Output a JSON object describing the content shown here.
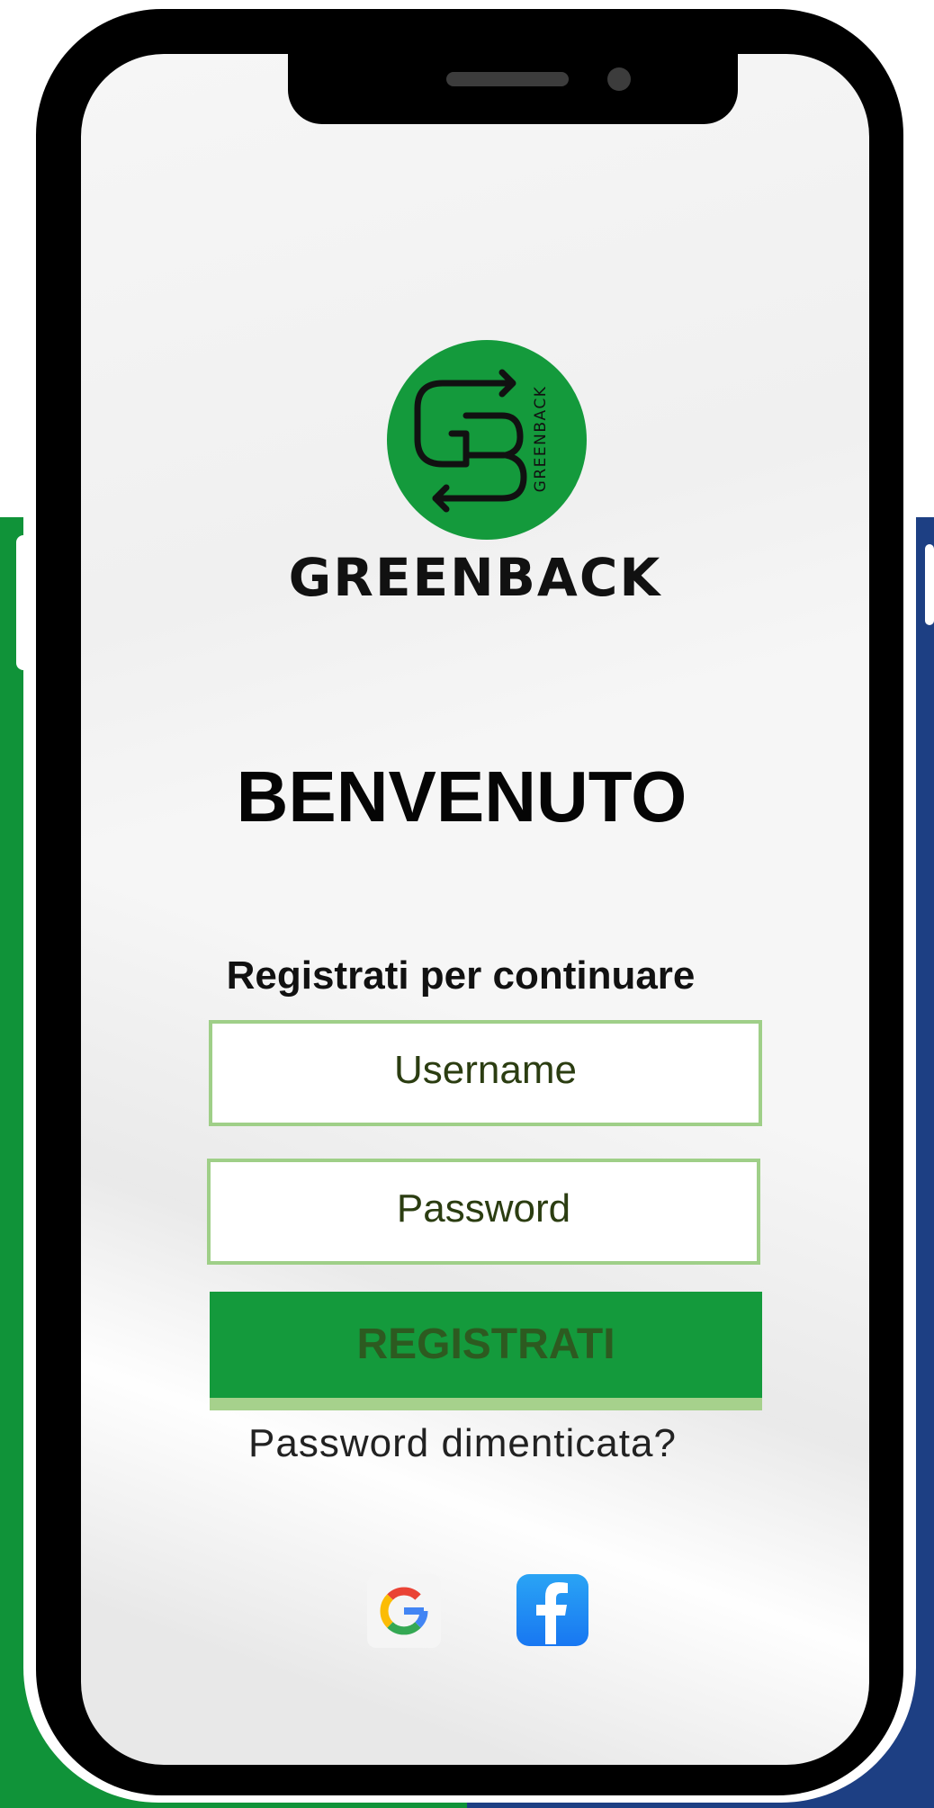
{
  "app": {
    "brand_name": "GREENBACK",
    "logo_monogram": "GB",
    "logo_ring_text": "GREENBACK"
  },
  "login": {
    "welcome_title": "BENVENUTO",
    "subtitle": "Registrati per continuare",
    "username_placeholder": "Username",
    "password_placeholder": "Password",
    "register_label": "REGISTRATI",
    "forgot_password_label": "Password dimenticata?"
  },
  "social": {
    "google_icon": "google-icon",
    "facebook_icon": "facebook-icon"
  },
  "colors": {
    "brand_green": "#149a3c",
    "field_border": "#9fcf88",
    "background_left": "#109339",
    "background_right": "#1d3f83"
  }
}
